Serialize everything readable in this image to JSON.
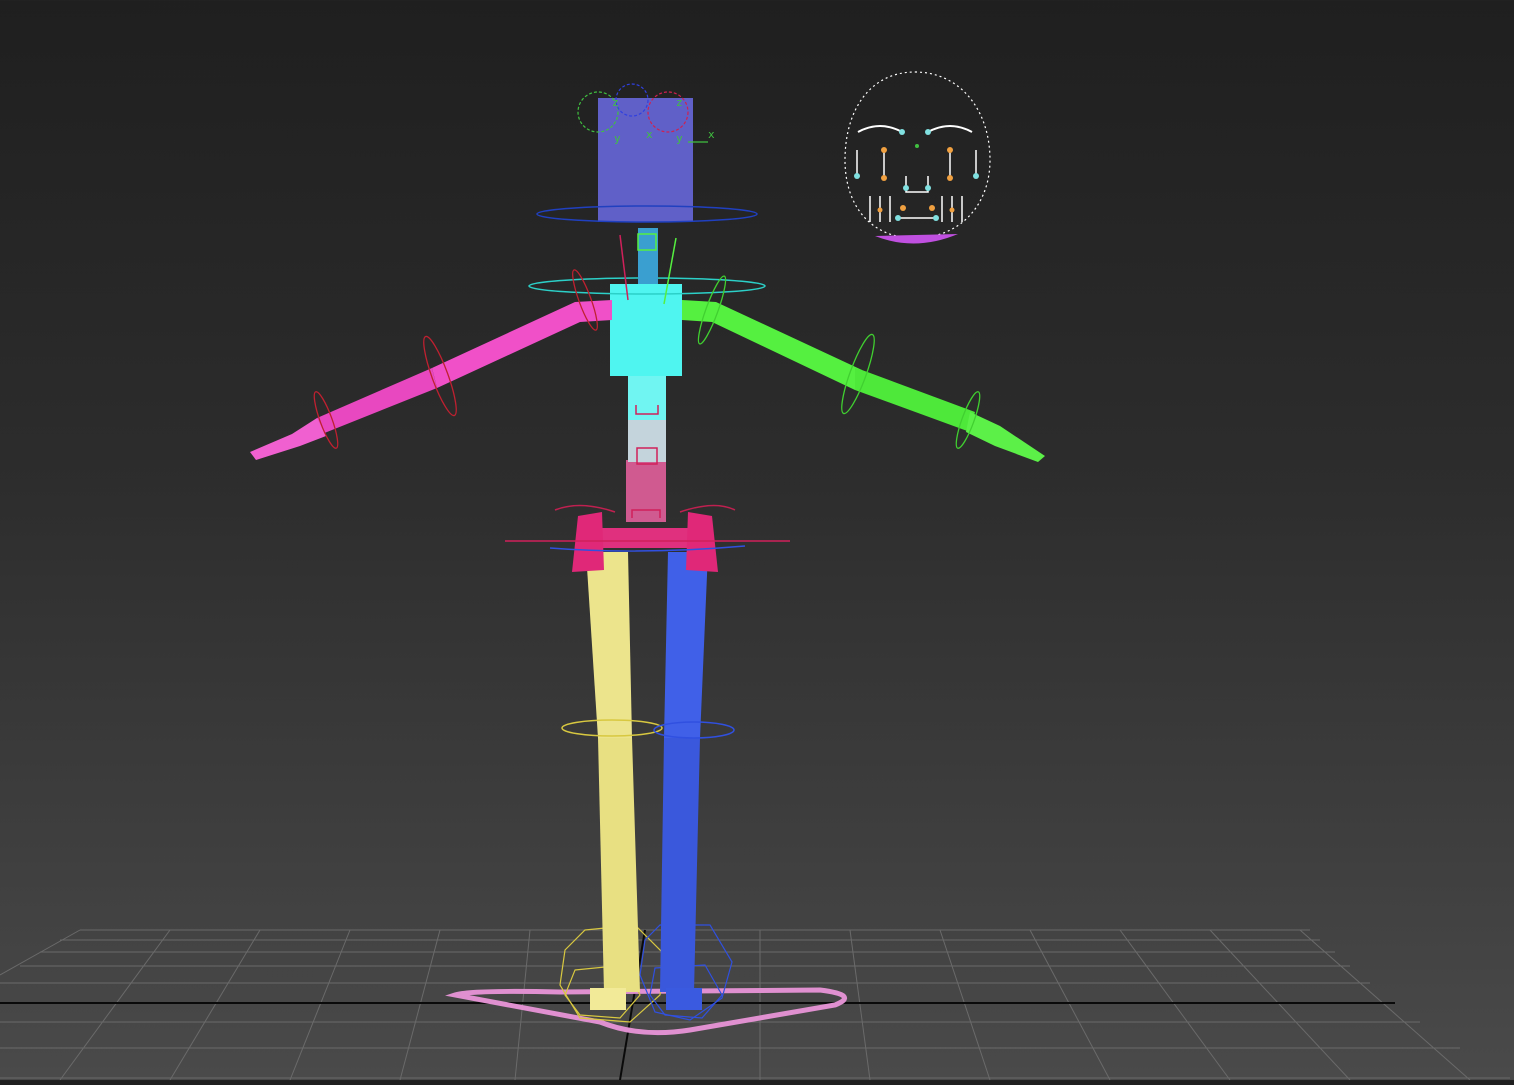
{
  "viewport": {
    "background_top": "#1f1f1f",
    "background_bottom": "#4a4a4a",
    "grid_color": "#6a6a6a",
    "axis_color": "#0a0a0a"
  },
  "head_gizmo": {
    "labels": [
      "z",
      "z",
      "y",
      "x",
      "y",
      "x"
    ]
  },
  "colors": {
    "head": "#6060c8",
    "neck": "#3a9fd0",
    "chest": "#4ff5f0",
    "spine_mid": "#c4d4dc",
    "spine_low": "#d05a90",
    "pelvis": "#e0307e",
    "left_arm": "#f050c8",
    "right_arm": "#55f040",
    "left_leg": "#ece48c",
    "right_leg": "#4060e8",
    "root_ctrl": "#e090d0",
    "face_panel": "#ffffff",
    "face_jaw": "#c050e0"
  }
}
